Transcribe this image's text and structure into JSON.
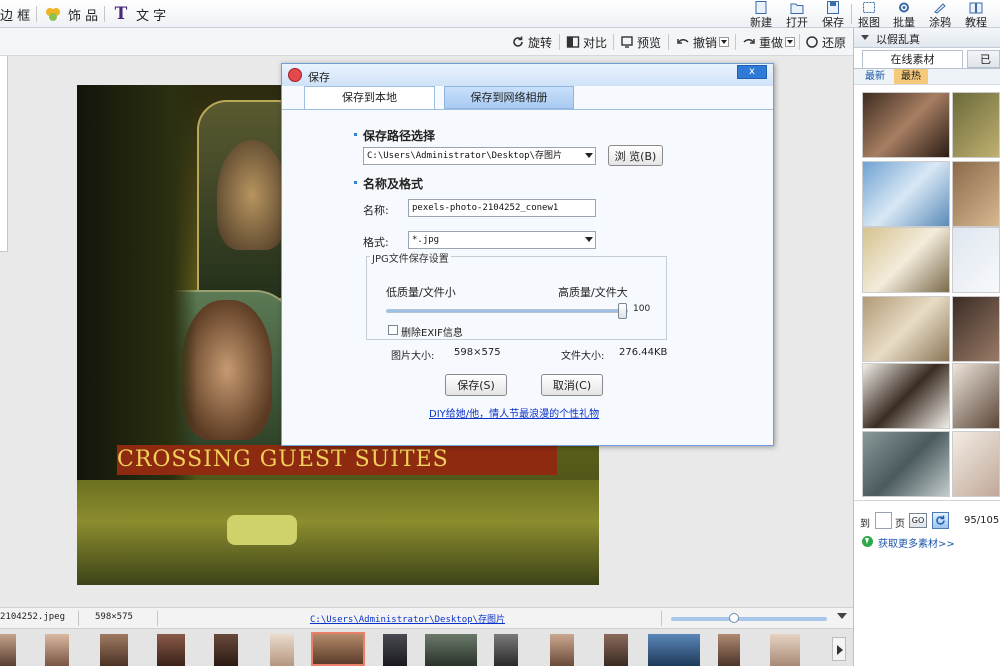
{
  "top_toolbar": {
    "border": "边 框",
    "decoration": "饰 品",
    "text": "文 字",
    "new": "新建",
    "open": "打开",
    "save": "保存",
    "cutout": "抠图",
    "batch": "批量",
    "doodle": "涂鸦",
    "tutorial": "教程"
  },
  "edit_toolbar": {
    "rotate": "旋转",
    "compare": "对比",
    "preview": "预览",
    "undo": "撤销",
    "redo": "重做",
    "restore": "还原"
  },
  "right_panel": {
    "header": "以假乱真",
    "tab_online": "在线素材",
    "tab_used": "已",
    "filter_latest": "最新",
    "filter_hot": "最热",
    "goto_label": "到",
    "page_label": "页",
    "go_button": "GO",
    "page_count": "95/105",
    "more_link": "获取更多素材>>"
  },
  "status_bar": {
    "filename": "2104252.jpeg",
    "dimensions": "598×575",
    "path": "C:\\Users\\Administrator\\Desktop\\存图片"
  },
  "photo": {
    "sign_text": "CROSSING GUEST SUITES"
  },
  "dialog": {
    "title": "保存",
    "close": "x",
    "tab_local": "保存到本地",
    "tab_album": "保存到网络相册",
    "path_section": "保存路径选择",
    "path_value": "C:\\Users\\Administrator\\Desktop\\存图片",
    "browse_button": "浏 览(B)",
    "name_section": "名称及格式",
    "name_label": "名称:",
    "name_value": "pexels-photo-2104252_conew1",
    "format_label": "格式:",
    "format_value": "*.jpg",
    "jpg_group": "JPG文件保存设置",
    "low_quality": "低质量/文件小",
    "high_quality": "高质量/文件大",
    "quality_value": "100",
    "quality": 100,
    "exif_label": "删除EXIF信息",
    "image_size_label": "图片大小:",
    "image_size_value": "598×575",
    "file_size_label": "文件大小:",
    "file_size_value": "276.44KB",
    "save_button": "保存(S)",
    "cancel_button": "取消(C)",
    "promo_link": "DIY给她/他，情人节最浪漫的个性礼物"
  },
  "colors": {
    "accent_blue": "#3a7fcf",
    "dialog_border": "#6f9fd8",
    "hot_tab": "#f5c97a",
    "link": "#0a33cc"
  }
}
